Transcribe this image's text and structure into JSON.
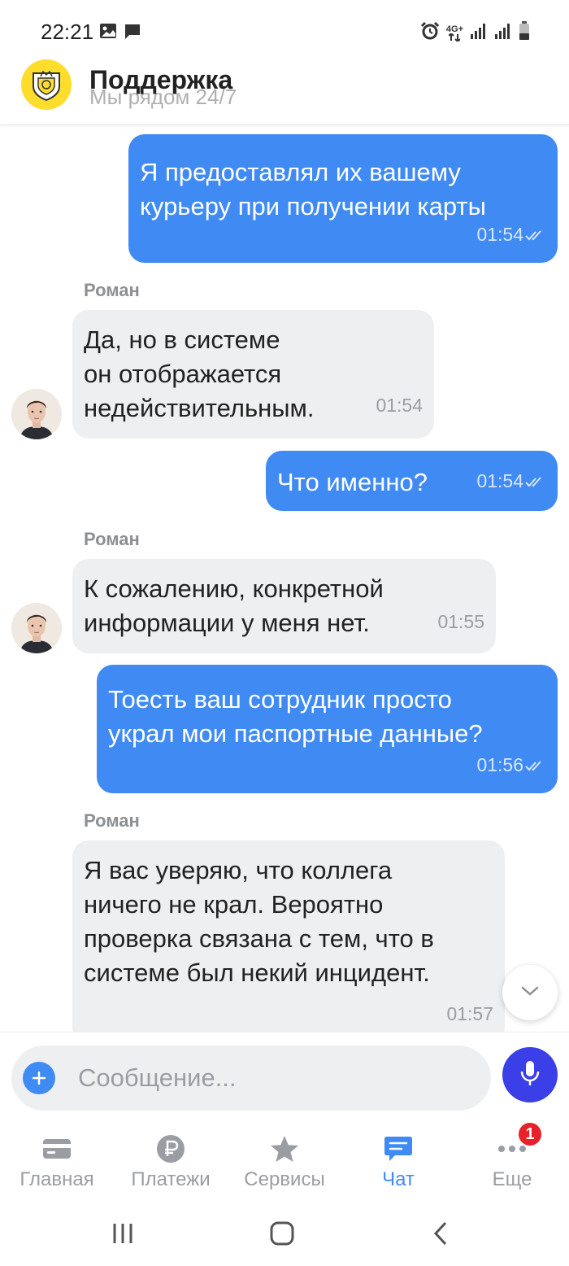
{
  "status_bar": {
    "time": "22:21",
    "network": "4G+",
    "left_icons": [
      "image-icon",
      "message-icon"
    ],
    "right_icons": [
      "alarm-icon",
      "network-icon",
      "signal-icon",
      "signal-icon",
      "battery-icon"
    ]
  },
  "header": {
    "title": "Поддержка",
    "subtitle": "Мы рядом 24/7",
    "logo_color": "#ffdd2d"
  },
  "chat": {
    "messages": [
      {
        "direction": "out",
        "lines": [
          "Я предоставлял их вашему",
          "курьеру при получении карты"
        ],
        "time": "01:54",
        "status": "read"
      },
      {
        "direction": "in",
        "sender": "Роман",
        "lines": [
          "Да, но в системе",
          "он отображается",
          "недействительным."
        ],
        "time": "01:54"
      },
      {
        "direction": "out",
        "lines": [
          "Что именно?"
        ],
        "time": "01:54",
        "status": "read"
      },
      {
        "direction": "in",
        "sender": "Роман",
        "lines": [
          "К сожалению, конкретной",
          "информации у меня нет."
        ],
        "time": "01:55"
      },
      {
        "direction": "out",
        "lines": [
          "Тоесть ваш сотрудник просто",
          "украл мои паспортные данные?"
        ],
        "time": "01:56",
        "status": "read"
      },
      {
        "direction": "in",
        "sender": "Роман",
        "lines": [
          "Я вас уверяю, что коллега",
          "ничего не крал. Вероятно",
          "проверка связана с тем, что в",
          "системе был некий инцидент."
        ],
        "time": "01:57"
      }
    ]
  },
  "composer": {
    "placeholder": "Сообщение...",
    "value": ""
  },
  "nav": {
    "items": [
      {
        "label": "Главная",
        "icon": "card-icon",
        "active": false
      },
      {
        "label": "Платежи",
        "icon": "ruble-icon",
        "active": false
      },
      {
        "label": "Сервисы",
        "icon": "star-icon",
        "active": false
      },
      {
        "label": "Чат",
        "icon": "chat-icon",
        "active": true
      },
      {
        "label": "Еще",
        "icon": "more-icon",
        "active": false,
        "badge": "1"
      }
    ]
  },
  "colors": {
    "accent": "#3f8bf3",
    "outgoing_bubble": "#3f8bf3",
    "incoming_bubble": "#eeeff1",
    "mic_button": "#3b3fe8",
    "badge": "#e8202a"
  }
}
